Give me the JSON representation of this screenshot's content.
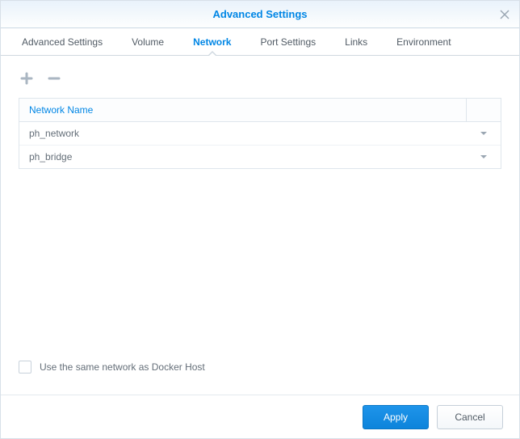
{
  "title": "Advanced Settings",
  "tabs": [
    {
      "label": "Advanced Settings"
    },
    {
      "label": "Volume"
    },
    {
      "label": "Network"
    },
    {
      "label": "Port Settings"
    },
    {
      "label": "Links"
    },
    {
      "label": "Environment"
    }
  ],
  "grid": {
    "header": "Network Name",
    "rows": [
      {
        "name": "ph_network"
      },
      {
        "name": "ph_bridge"
      }
    ]
  },
  "options": {
    "use_host_net_label": "Use the same network as Docker Host"
  },
  "buttons": {
    "apply": "Apply",
    "cancel": "Cancel"
  }
}
